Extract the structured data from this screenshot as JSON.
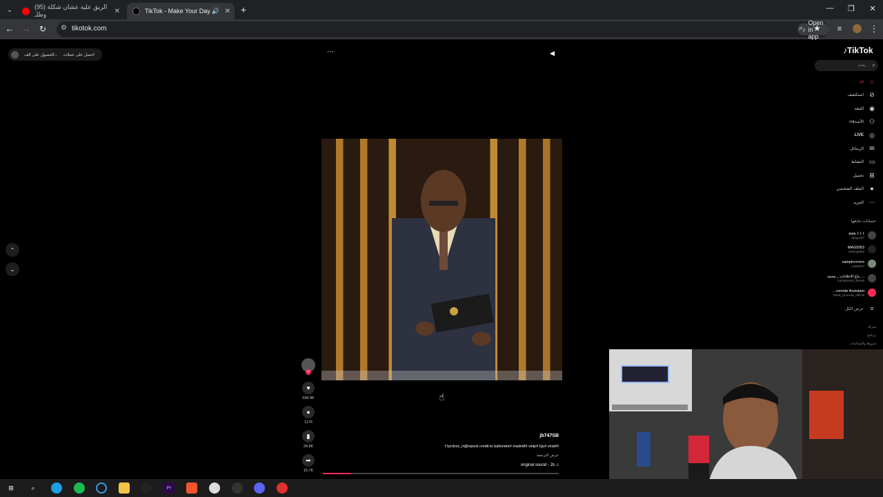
{
  "browser": {
    "tabs": [
      {
        "title": "(95) الريق علية عشان شكلة وطلـ",
        "active": false
      },
      {
        "title": "TikTok - Make Your Day",
        "active": true
      }
    ],
    "url": "tikotok.com",
    "open_in_app": "Open in app"
  },
  "page": {
    "top_pill": {
      "label1": "الحصول على الف...",
      "label2": "احصل على عملات"
    },
    "counts": {
      "likes": "594.9K",
      "comments": "1176",
      "saves": "34.8K",
      "shares": "15.7K"
    },
    "caption": {
      "author": "jb747SB",
      "hashtag_prefix": "#",
      "text": "††prdzzz_rt@repost credit to ballondor# madridl# vinijr# fyp# viral#",
      "translate": "عرض الترجمة",
      "sound": "original sound - Jb"
    },
    "sidebar": {
      "logo": "TikTok",
      "search_placeholder": "بحث",
      "nav": [
        {
          "label": "لك",
          "icon": "home-icon",
          "accent": "#fe2c55"
        },
        {
          "label": "استكشف",
          "icon": "explore-icon"
        },
        {
          "label": "التبعه",
          "icon": "following-icon"
        },
        {
          "label": "الأصدقاء",
          "icon": "friends-icon"
        },
        {
          "label": "LIVE",
          "icon": "live-icon"
        },
        {
          "label": "الرسائل",
          "icon": "messages-icon"
        },
        {
          "label": "النشاط",
          "icon": "activity-icon"
        },
        {
          "label": "تحميل",
          "icon": "upload-icon"
        },
        {
          "label": "الملف الشخصي",
          "icon": "profile-icon"
        },
        {
          "label": "المزيد",
          "icon": "more-icon"
        }
      ],
      "following_title": "حسابات تتابعها",
      "following": [
        {
          "name": "ᴊᴇʀꜱ ⸸ ⸸ ⸸",
          "user": "beigoo97"
        },
        {
          "name": "MAGDI53",
          "user": "mamagdi53"
        },
        {
          "name": "vampirrrrrrrre",
          "user": "_vampirrrr"
        },
        {
          "name": "بتاع الاعلانات _ محمد ...",
          "user": "mohaamerd_fareek"
        },
        {
          "name": "...romote Assistant",
          "user": "tiktok_promote_official"
        }
      ],
      "see_all": "عرض الكل",
      "footer": [
        "شركة",
        "برنامج",
        "شروط والسياسات"
      ]
    }
  }
}
